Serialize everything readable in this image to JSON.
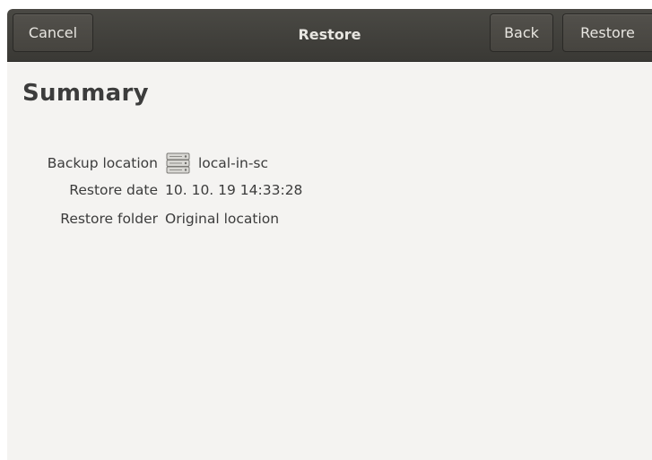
{
  "header": {
    "title": "Restore",
    "cancel_label": "Cancel",
    "back_label": "Back",
    "restore_label": "Restore"
  },
  "summary": {
    "heading": "Summary",
    "rows": [
      {
        "label": "Backup location",
        "value": "local-in-sc",
        "icon": "server-icon"
      },
      {
        "label": "Restore date",
        "value": "10. 10. 19 14:33:28"
      },
      {
        "label": "Restore folder",
        "value": "Original location"
      }
    ]
  },
  "colors": {
    "headerbar": "#3f3e3a",
    "window_bg": "#f4f3f1",
    "text": "#3c3c3c",
    "header_text": "#e8e6e1"
  }
}
